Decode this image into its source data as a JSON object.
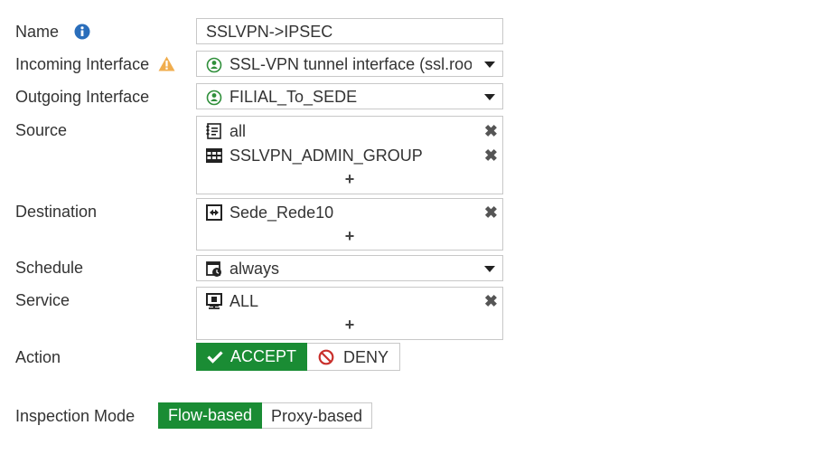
{
  "labels": {
    "name": "Name",
    "incoming": "Incoming Interface",
    "outgoing": "Outgoing Interface",
    "source": "Source",
    "destination": "Destination",
    "schedule": "Schedule",
    "service": "Service",
    "action": "Action",
    "inspection": "Inspection Mode"
  },
  "name_value": "SSLVPN->IPSEC",
  "incoming": {
    "value": "SSL-VPN tunnel interface (ssl.root)",
    "icon": "interface-icon"
  },
  "outgoing": {
    "value": "FILIAL_To_SEDE",
    "icon": "interface-icon"
  },
  "source": {
    "items": [
      {
        "label": "all",
        "icon": "address-icon"
      },
      {
        "label": "SSLVPN_ADMIN_GROUP",
        "icon": "group-icon"
      }
    ],
    "add": "+"
  },
  "destination": {
    "items": [
      {
        "label": "Sede_Rede10",
        "icon": "range-icon"
      }
    ],
    "add": "+"
  },
  "schedule": {
    "value": "always",
    "icon": "schedule-icon"
  },
  "service": {
    "items": [
      {
        "label": "ALL",
        "icon": "service-icon"
      }
    ],
    "add": "+"
  },
  "action": {
    "accept": "ACCEPT",
    "deny": "DENY",
    "selected": "ACCEPT"
  },
  "inspection_mode": {
    "flow": "Flow-based",
    "proxy": "Proxy-based",
    "selected": "Flow-based"
  },
  "colors": {
    "accent": "#1a8c34",
    "info": "#2a6ebb",
    "warning": "#f0ad4e",
    "deny": "#c9302c",
    "interface": "#2f8f3a"
  }
}
